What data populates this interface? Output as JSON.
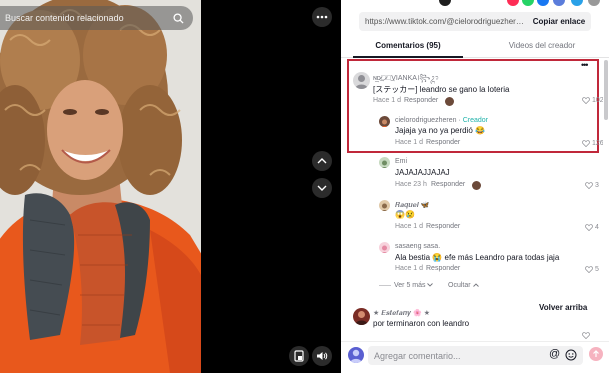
{
  "video": {
    "search_placeholder": "Buscar contenido relacionado",
    "icons": [
      "search-icon",
      "more-icon",
      "chevron-up-icon",
      "chevron-down-icon",
      "device-icon",
      "volume-icon"
    ]
  },
  "panel": {
    "url": "https://www.tiktok.com/@cielorodriguezheren/vid...",
    "copy_link": "Copiar enlace",
    "tabs": [
      {
        "label": "Comentarios (95)",
        "active": true
      },
      {
        "label": "Videos del creador",
        "active": false
      }
    ],
    "comments": [
      {
        "user": "ɴ͢ᴅ̷͢ꪆ̷ꪳ͢VIANKA꫰꧂ᬊ",
        "text": "[ステッカー] leandro se gano la loteria",
        "time": "Hace 1 d",
        "reply": "Responder",
        "likes": "102",
        "more": "•••",
        "highlighted": true,
        "replies": [
          {
            "user": "cielorodriguezheren",
            "badge": "Creador",
            "text": "Jajaja ya no ya perdió 😂",
            "time": "Hace 1 d",
            "reply": "Responder",
            "likes": "126"
          },
          {
            "user": "Emi",
            "text": "JAJAJAJJAJAJ",
            "time": "Hace 23 h",
            "reply": "Responder",
            "likes": "3"
          },
          {
            "user": "𝑹𝒂𝒒𝒖𝒆𝒍 🦋",
            "text": "😱😢",
            "time": "Hace 1 d",
            "reply": "Responder",
            "likes": "4"
          },
          {
            "user": "sasaeng sasa.",
            "text": "Ala bestia 😭 efe más Leandro para todas jaja",
            "time": "Hace 1 d",
            "reply": "Responder",
            "likes": "5"
          }
        ],
        "view_more": "Ver 5 más",
        "hide": "Ocultar"
      },
      {
        "user": "★ 𝑬𝒔𝒕𝒆𝒇𝒂𝒏𝒚 🌸 ★",
        "text": "por terminaron con leandro",
        "likes": ""
      }
    ],
    "scroll_up": "Volver arriba",
    "composer_placeholder": "Agregar comentario...",
    "composer_icons": [
      "mention-icon",
      "emoji-icon",
      "send-icon"
    ]
  },
  "colors": {
    "creator": "#20b2aa",
    "highlight": "#c0283a",
    "tiktok_pink": "#fe2c55"
  }
}
